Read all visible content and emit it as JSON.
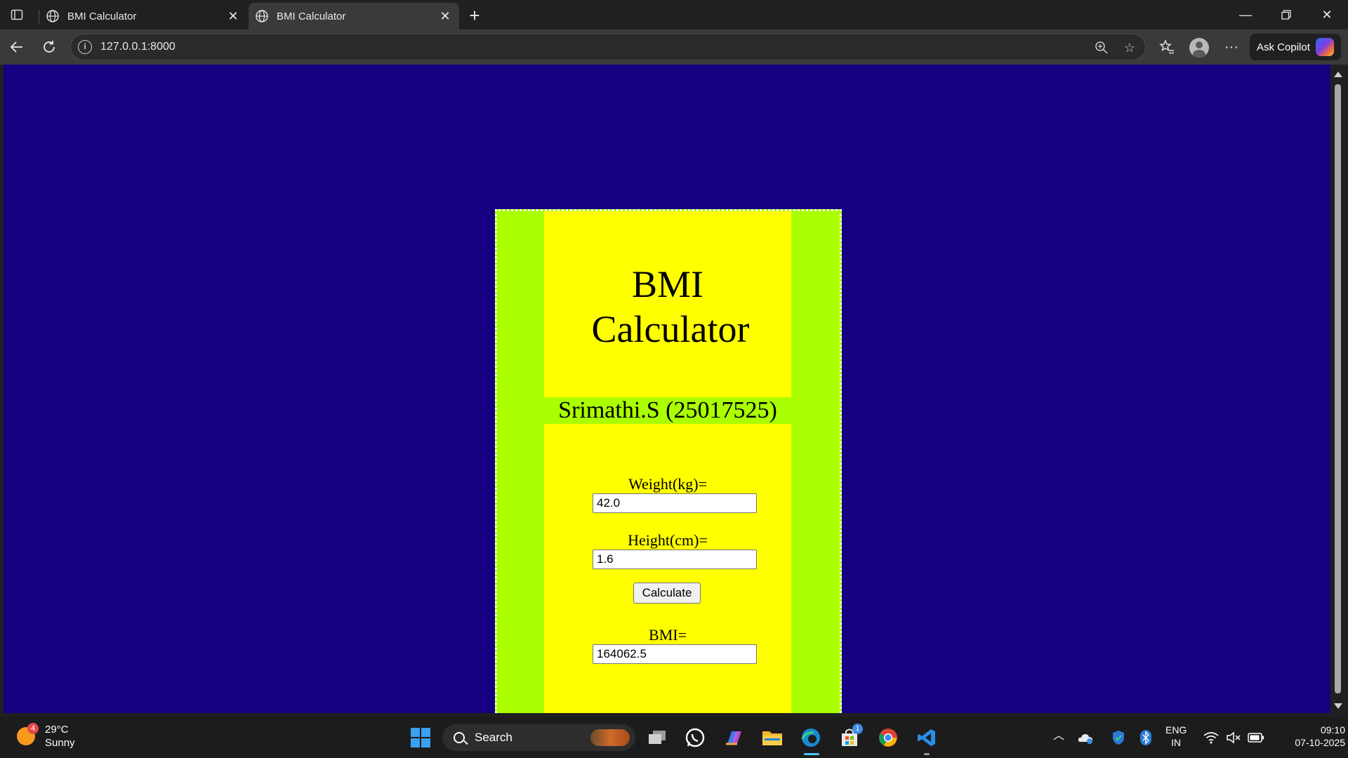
{
  "browser": {
    "tabs": [
      {
        "title": "BMI Calculator",
        "active": false
      },
      {
        "title": "BMI Calculator",
        "active": true
      }
    ],
    "url": "127.0.0.1:8000",
    "copilot_label": "Ask Copilot"
  },
  "page": {
    "heading_line1": "BMI",
    "heading_line2": "Calculator",
    "student": "Srimathi.S (25017525)",
    "weight_label": "Weight(kg)=",
    "weight_value": "42.0",
    "height_label": "Height(cm)=",
    "height_value": "1.6",
    "calculate_label": "Calculate",
    "bmi_label": "BMI=",
    "bmi_value": "164062.5",
    "colors": {
      "background": "#140080",
      "outer": "#aaff00",
      "inner": "#ffff00"
    }
  },
  "taskbar": {
    "weather": {
      "temp": "29°C",
      "condition": "Sunny",
      "badge": "4"
    },
    "search_label": "Search",
    "store_badge": "1",
    "language": {
      "line1": "ENG",
      "line2": "IN"
    },
    "clock": {
      "time": "09:10",
      "date": "07-10-2025"
    }
  }
}
